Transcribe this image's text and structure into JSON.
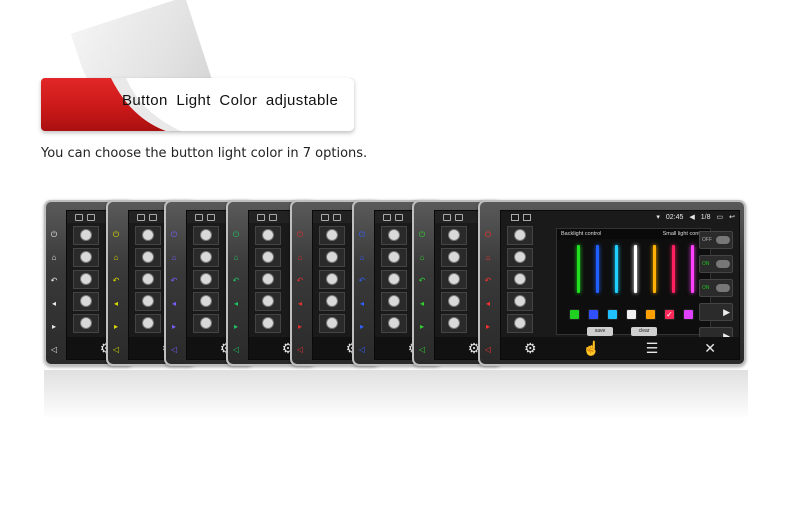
{
  "banner": {
    "title": "Button Light Color adjustable",
    "accent_color": "#d01f1f"
  },
  "subtitle": "You can choose the button light color in 7 options.",
  "devices": {
    "button_light_colors": [
      "#e8e8e8",
      "#d8d800",
      "#7a5cff",
      "#20c060",
      "#e03030",
      "#3060ff",
      "#30d030",
      "#ff3030"
    ]
  },
  "front_screen": {
    "time": "02:45",
    "page": "1/8",
    "panel_title": "Backlight control",
    "panel_right": "Small light control",
    "off_label": "OFF",
    "on_label_1": "ON",
    "on_label_2": "ON",
    "btn_a": "save",
    "btn_b": "clear",
    "bar_colors": [
      "#20e020",
      "#2060ff",
      "#20d0ff",
      "#ffffff",
      "#ffb000",
      "#ff2060",
      "#ff40ff"
    ],
    "swatch_colors": [
      "#20d020",
      "#3050ff",
      "#20c0ff",
      "#f0f0f0",
      "#ffa000",
      "#ff2a5a",
      "#e040ff"
    ],
    "selected_swatch": "#ff2a5a"
  },
  "icons": [
    "settings-icon",
    "volume-icon",
    "bluetooth-icon",
    "ir-icon",
    "cam-icon",
    "home-icon",
    "back-icon",
    "eq-icon",
    "tools-icon"
  ]
}
